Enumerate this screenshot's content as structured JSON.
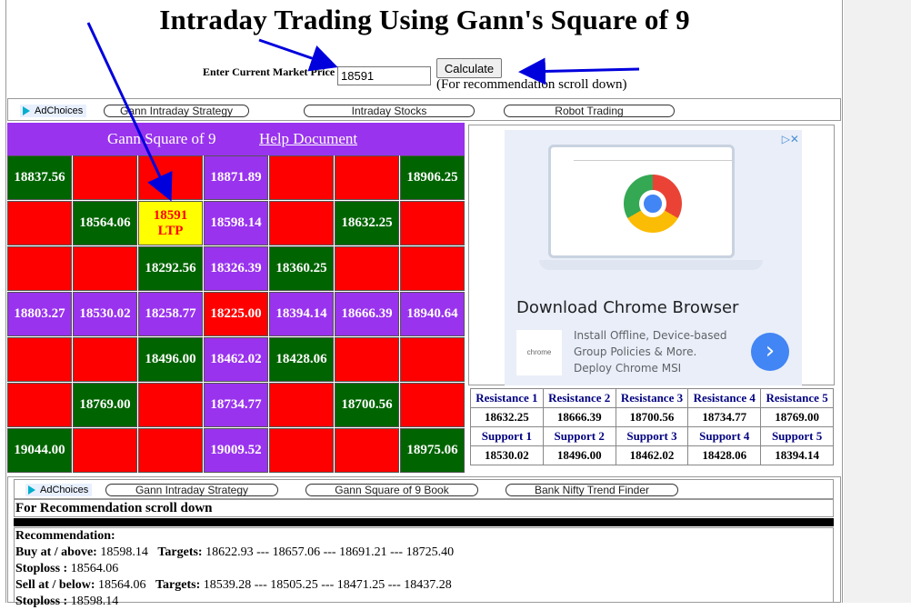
{
  "page_title": "Intraday Trading Using Gann's Square of 9",
  "price_form": {
    "label": "Enter Current Market Price",
    "value": "18591",
    "button": "Calculate",
    "note": "(For recommendation scroll down)"
  },
  "ad_bar_top": {
    "adchoices": "AdChoices",
    "links": [
      "Gann Intraday Strategy",
      "Intraday Stocks",
      "Robot Trading"
    ]
  },
  "gann": {
    "title": "Gann Square of 9",
    "help": "Help Document",
    "rows": [
      [
        {
          "v": "18837.56",
          "c": "green"
        },
        {
          "v": "",
          "c": "red"
        },
        {
          "v": "",
          "c": "red"
        },
        {
          "v": "18871.89",
          "c": "purple"
        },
        {
          "v": "",
          "c": "red"
        },
        {
          "v": "",
          "c": "red"
        },
        {
          "v": "18906.25",
          "c": "green"
        }
      ],
      [
        {
          "v": "",
          "c": "red"
        },
        {
          "v": "18564.06",
          "c": "green"
        },
        {
          "v": "18591",
          "v2": "LTP",
          "c": "yellow"
        },
        {
          "v": "18598.14",
          "c": "purple"
        },
        {
          "v": "",
          "c": "red"
        },
        {
          "v": "18632.25",
          "c": "green"
        },
        {
          "v": "",
          "c": "red"
        }
      ],
      [
        {
          "v": "",
          "c": "red"
        },
        {
          "v": "",
          "c": "red"
        },
        {
          "v": "18292.56",
          "c": "green"
        },
        {
          "v": "18326.39",
          "c": "purple"
        },
        {
          "v": "18360.25",
          "c": "green"
        },
        {
          "v": "",
          "c": "red"
        },
        {
          "v": "",
          "c": "red"
        }
      ],
      [
        {
          "v": "18803.27",
          "c": "purple"
        },
        {
          "v": "18530.02",
          "c": "purple"
        },
        {
          "v": "18258.77",
          "c": "purple"
        },
        {
          "v": "18225.00",
          "c": "red"
        },
        {
          "v": "18394.14",
          "c": "purple"
        },
        {
          "v": "18666.39",
          "c": "purple"
        },
        {
          "v": "18940.64",
          "c": "purple"
        }
      ],
      [
        {
          "v": "",
          "c": "red"
        },
        {
          "v": "",
          "c": "red"
        },
        {
          "v": "18496.00",
          "c": "green"
        },
        {
          "v": "18462.02",
          "c": "purple"
        },
        {
          "v": "18428.06",
          "c": "green"
        },
        {
          "v": "",
          "c": "red"
        },
        {
          "v": "",
          "c": "red"
        }
      ],
      [
        {
          "v": "",
          "c": "red"
        },
        {
          "v": "18769.00",
          "c": "green"
        },
        {
          "v": "",
          "c": "red"
        },
        {
          "v": "18734.77",
          "c": "purple"
        },
        {
          "v": "",
          "c": "red"
        },
        {
          "v": "18700.56",
          "c": "green"
        },
        {
          "v": "",
          "c": "red"
        }
      ],
      [
        {
          "v": "19044.00",
          "c": "green"
        },
        {
          "v": "",
          "c": "red"
        },
        {
          "v": "",
          "c": "red"
        },
        {
          "v": "19009.52",
          "c": "purple"
        },
        {
          "v": "",
          "c": "red"
        },
        {
          "v": "",
          "c": "red"
        },
        {
          "v": "18975.06",
          "c": "green"
        }
      ]
    ]
  },
  "ad_right": {
    "title": "Download Chrome Browser",
    "logo_text": "chrome",
    "description": "Install Offline, Device-based Group Policies & More. Deploy Chrome MSI",
    "arrow": "›"
  },
  "levels": {
    "resistance_labels": [
      "Resistance 1",
      "Resistance 2",
      "Resistance 3",
      "Resistance 4",
      "Resistance 5"
    ],
    "resistance_values": [
      "18632.25",
      "18666.39",
      "18700.56",
      "18734.77",
      "18769.00"
    ],
    "support_labels": [
      "Support 1",
      "Support 2",
      "Support 3",
      "Support 4",
      "Support 5"
    ],
    "support_values": [
      "18530.02",
      "18496.00",
      "18462.02",
      "18428.06",
      "18394.14"
    ]
  },
  "ad_bar_bottom": {
    "adchoices": "AdChoices",
    "links": [
      "Gann Intraday Strategy",
      "Gann Square of 9 Book",
      "Bank Nifty Trend Finder"
    ]
  },
  "recommendation": {
    "header": "For Recommendation scroll down",
    "title": "Recommendation:",
    "buy_label": "Buy at / above:",
    "buy_value": "18598.14",
    "buy_targets_label": "Targets:",
    "buy_targets": "18622.93 --- 18657.06 --- 18691.21 --- 18725.40",
    "buy_stoploss_label": "Stoploss :",
    "buy_stoploss": "18564.06",
    "sell_label": "Sell at / below:",
    "sell_value": "18564.06",
    "sell_targets_label": "Targets:",
    "sell_targets": "18539.28 --- 18505.25 --- 18471.25 --- 18437.28",
    "sell_stoploss_label": "Stoploss :",
    "sell_stoploss": "18598.14"
  },
  "colors": {
    "green": "#006400",
    "red": "#ff0000",
    "purple": "#9933ee",
    "yellow": "#ffff00",
    "arrow": "#0000dd"
  }
}
